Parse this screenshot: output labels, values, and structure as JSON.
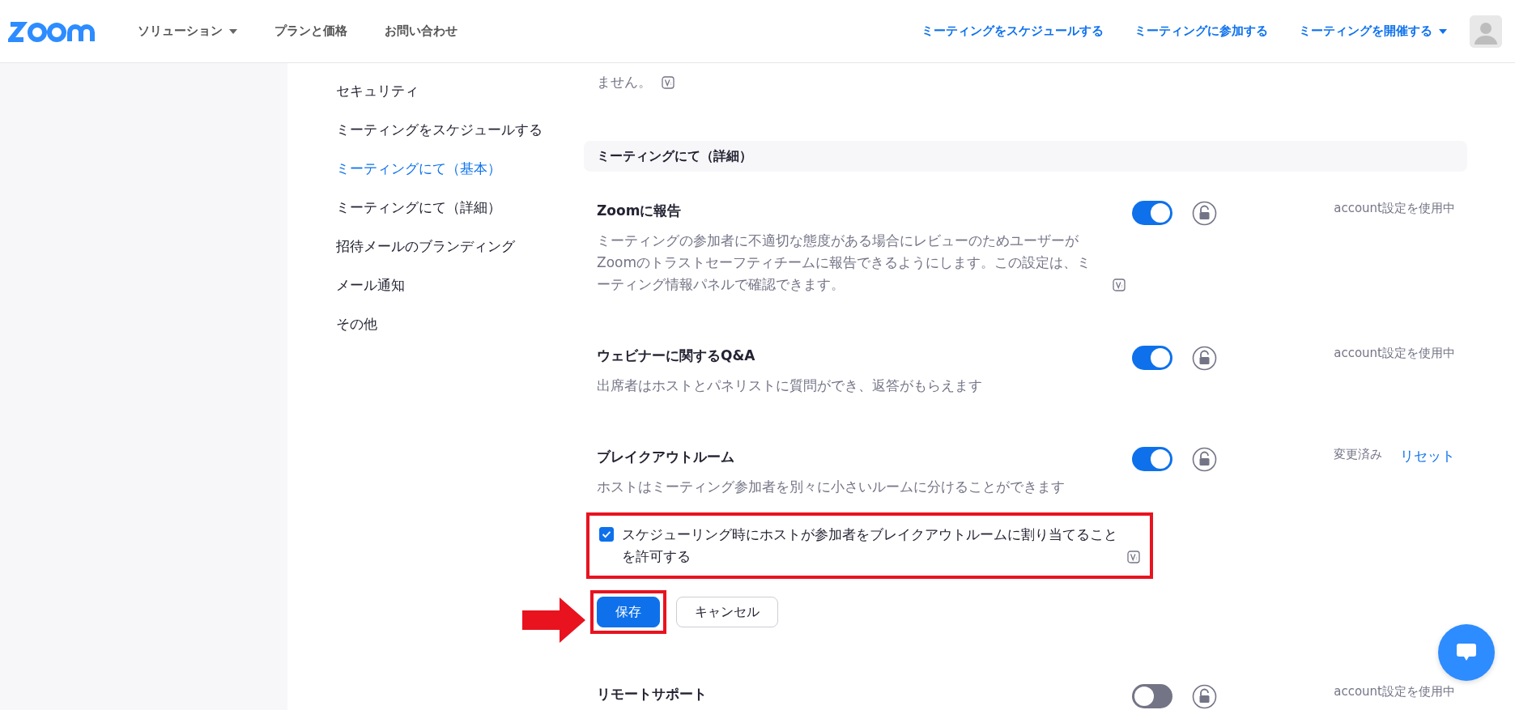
{
  "header": {
    "nav": [
      {
        "label": "ソリューション",
        "dropdown": true
      },
      {
        "label": "プランと価格",
        "dropdown": false
      },
      {
        "label": "お問い合わせ",
        "dropdown": false
      }
    ],
    "actions": [
      {
        "label": "ミーティングをスケジュールする",
        "dropdown": false
      },
      {
        "label": "ミーティングに参加する",
        "dropdown": false
      },
      {
        "label": "ミーティングを開催する",
        "dropdown": true
      }
    ]
  },
  "sidebar": {
    "items": [
      {
        "label": "セキュリティ",
        "selected": false
      },
      {
        "label": "ミーティングをスケジュールする",
        "selected": false
      },
      {
        "label": "ミーティングにて（基本）",
        "selected": true
      },
      {
        "label": "ミーティングにて（詳細）",
        "selected": false
      },
      {
        "label": "招待メールのブランディング",
        "selected": false
      },
      {
        "label": "メール通知",
        "selected": false
      },
      {
        "label": "その他",
        "selected": false
      }
    ]
  },
  "previous_setting": {
    "description_tail": "ません。",
    "info_icon": true
  },
  "section": {
    "title": "ミーティングにて（詳細）",
    "settings": [
      {
        "title": "Zoomに報告",
        "description": "ミーティングの参加者に不適切な態度がある場合にレビューのためユーザーがZoomのトラストセーフティチームに報告できるようにします。この設定は、ミーティング情報パネルで確認できます。",
        "info_icon": true,
        "on": true,
        "status": "account設定を使用中"
      },
      {
        "title": "ウェビナーに関するQ&A",
        "description": "出席者はホストとパネリストに質問ができ、返答がもらえます",
        "info_icon": false,
        "on": true,
        "status": "account設定を使用中"
      },
      {
        "title": "ブレイクアウトルーム",
        "description": "ホストはミーティング参加者を別々に小さいルームに分けることができます",
        "info_icon": false,
        "on": true,
        "status": "変更済み",
        "reset": "リセット",
        "option": {
          "label": "スケジューリング時にホストが参加者をブレイクアウトルームに割り当てることを許可する",
          "checked": true,
          "highlighted": true,
          "info_icon": true
        },
        "buttons": [
          {
            "label": "保存",
            "kind": "primary",
            "highlighted": true
          },
          {
            "label": "キャンセル",
            "kind": "secondary",
            "highlighted": false
          }
        ]
      },
      {
        "title": "リモートサポート",
        "on": false,
        "status": "account設定を使用中"
      }
    ]
  }
}
